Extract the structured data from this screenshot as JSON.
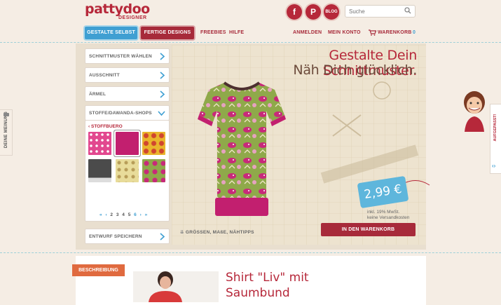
{
  "header": {
    "logo_main": "pattydoo",
    "logo_sub": "DESIGNER",
    "social": [
      {
        "label": "f",
        "name": "facebook-icon"
      },
      {
        "label": "P",
        "name": "pinterest-icon"
      },
      {
        "label": "BLOG",
        "name": "blog-icon"
      }
    ],
    "search_placeholder": "Suche",
    "nav": {
      "gestalte": "GESTALTE SELBST",
      "fertige": "FERTIGE DESIGNS",
      "freebies": "FREEBIES",
      "hilfe": "HILFE",
      "anmelden": "ANMELDEN",
      "konto": "MEIN KONTO",
      "warenkorb": "WARENKORB",
      "cart_count": "0"
    }
  },
  "sidebar": {
    "items": [
      {
        "label": "SCHNITTMUSTER WÄHLEN"
      },
      {
        "label": "AUSSCHNITT"
      },
      {
        "label": "ÄRMEL"
      },
      {
        "label": "STOFFE/DAWANDA-SHOPS"
      }
    ],
    "shop_name": "STOFFBUERO",
    "pagination": [
      "2",
      "3",
      "4",
      "5",
      "6"
    ],
    "save_label": "ENTWURF SPEICHERN"
  },
  "designer": {
    "tagline_1": "Gestalte Dein Schnittmuster.",
    "tagline_2": "Näh Dich glücklich.",
    "price": "2,99 €",
    "vat_note": "inkl. 19% MwSt.",
    "shipping_note": "keine Versandkosten",
    "sizes_link": "GRÖSSEN, MAßE, NÄHTIPPS",
    "add_to_cart": "IN DEN WARENKORB"
  },
  "product": {
    "section_label": "BESCHREIBUNG",
    "title_line1": "Shirt \"Liv\" mit",
    "title_line2": "Saumbund"
  },
  "side_tabs": {
    "feedback": "DEINE MEINUNG",
    "aufgepasst": "AUFGEPASST!"
  },
  "colors": {
    "brand_red": "#b6283a",
    "accent_blue": "#3f9fd2",
    "price_tag": "#5eb6dc",
    "fabric_green": "#8fa94a",
    "fabric_pink": "#c8297a"
  }
}
